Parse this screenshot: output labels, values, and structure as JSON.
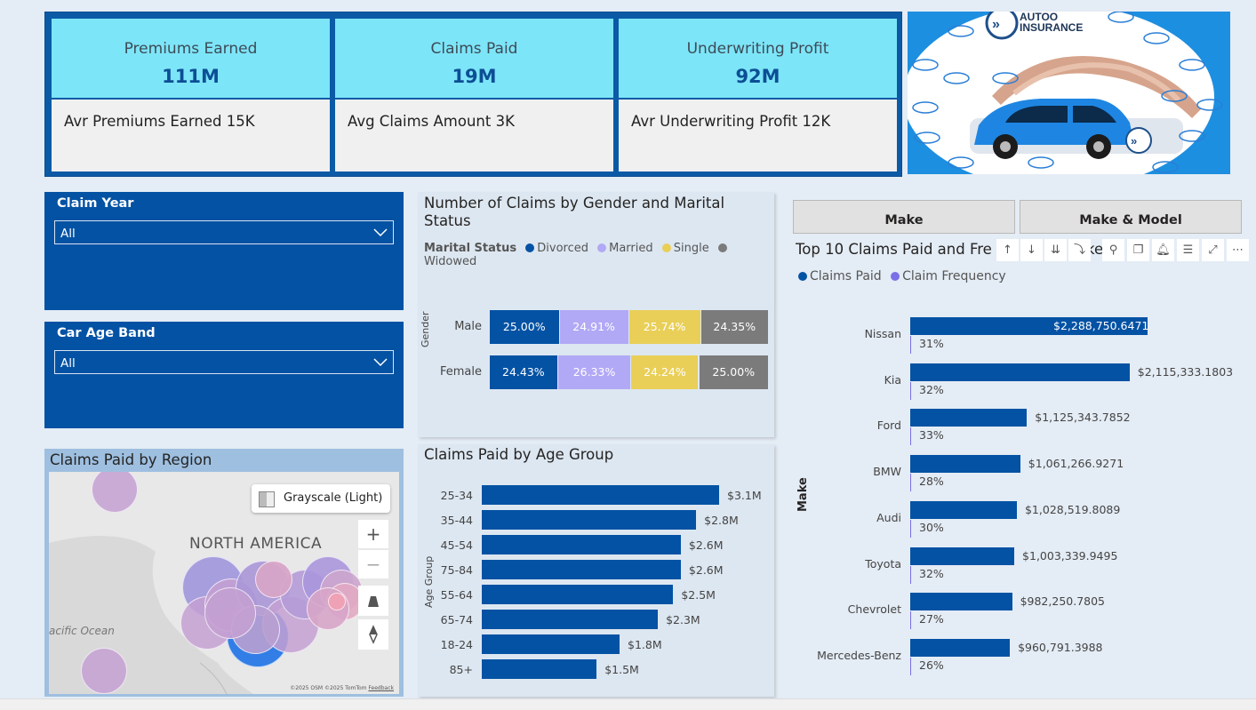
{
  "kpis": [
    {
      "label": "Premiums Earned",
      "value": "111M",
      "sub": "Avr Premiums Earned 15K"
    },
    {
      "label": "Claims Paid",
      "value": "19M",
      "sub": "Avg Claims Amount 3K"
    },
    {
      "label": "Underwriting Profit",
      "value": "92M",
      "sub": "Avr Underwriting Profit 12K"
    }
  ],
  "logo": {
    "line1": "AUTOO",
    "line2": "INSURANCE"
  },
  "slicers": {
    "claim_year": {
      "title": "Claim Year",
      "value": "All"
    },
    "car_age_band": {
      "title": "Car Age Band",
      "value": "All"
    }
  },
  "buttons": {
    "make": "Make",
    "make_model": "Make & Model"
  },
  "map": {
    "title": "Claims Paid by Region",
    "style_button": "Grayscale (Light)",
    "continent": "NORTH AMERICA",
    "ocean": "acific Ocean",
    "zoom_in": "+",
    "zoom_out": "−",
    "attribution": "©2025 OSM ©2025 TomTom",
    "feedback": "Feedback"
  },
  "colors": {
    "divorced": "#0452a4",
    "married": "#b1a9f5",
    "single": "#e9cf58",
    "widowed": "#7b7b7b",
    "claims_paid": "#0452a4",
    "claim_frequency": "#7b6fe6"
  },
  "chart_data": [
    {
      "type": "bar",
      "stacked": "100%",
      "title": "Number of Claims by Gender and Marital Status",
      "legend_title": "Marital Status",
      "ylabel": "Gender",
      "categories": [
        "Male",
        "Female"
      ],
      "series": [
        {
          "name": "Divorced",
          "values": [
            25.0,
            24.43
          ],
          "labels": [
            "25.00%",
            "24.43%"
          ]
        },
        {
          "name": "Married",
          "values": [
            24.91,
            26.33
          ],
          "labels": [
            "24.91%",
            "26.33%"
          ]
        },
        {
          "name": "Single",
          "values": [
            25.74,
            24.24
          ],
          "labels": [
            "25.74%",
            "24.24%"
          ]
        },
        {
          "name": "Widowed",
          "values": [
            24.35,
            25.0
          ],
          "labels": [
            "24.35%",
            "25.00%"
          ]
        }
      ]
    },
    {
      "type": "bar",
      "title": "Claims Paid by Age Group",
      "ylabel": "Age Group",
      "categories": [
        "25-34",
        "35-44",
        "45-54",
        "75-84",
        "55-64",
        "65-74",
        "18-24",
        "85+"
      ],
      "values": [
        3.1,
        2.8,
        2.6,
        2.6,
        2.5,
        2.3,
        1.8,
        1.5
      ],
      "labels": [
        "$3.1M",
        "$2.8M",
        "$2.6M",
        "$2.6M",
        "$2.5M",
        "$2.3M",
        "$1.8M",
        "$1.5M"
      ]
    },
    {
      "type": "bar",
      "title": "Top 10 Claims Paid and Fre",
      "title_tail": "ke",
      "ylabel": "Make",
      "categories": [
        "Nissan",
        "Kia",
        "Ford",
        "BMW",
        "Audi",
        "Toyota",
        "Chevrolet",
        "Mercedes-Benz"
      ],
      "series": [
        {
          "name": "Claims Paid",
          "values": [
            2288750.6471,
            2115333.1803,
            1125343.7852,
            1061266.9271,
            1028519.8089,
            1003339.9495,
            982250.7805,
            960791.3988
          ],
          "labels": [
            "$2,288,750.6471",
            "$2,115,333.1803",
            "$1,125,343.7852",
            "$1,061,266.9271",
            "$1,028,519.8089",
            "$1,003,339.9495",
            "$982,250.7805",
            "$960,791.3988"
          ]
        },
        {
          "name": "Claim Frequency",
          "values": [
            31,
            32,
            33,
            28,
            30,
            32,
            27,
            26
          ],
          "labels": [
            "31%",
            "32%",
            "33%",
            "28%",
            "30%",
            "32%",
            "27%",
            "26%"
          ]
        }
      ]
    }
  ]
}
